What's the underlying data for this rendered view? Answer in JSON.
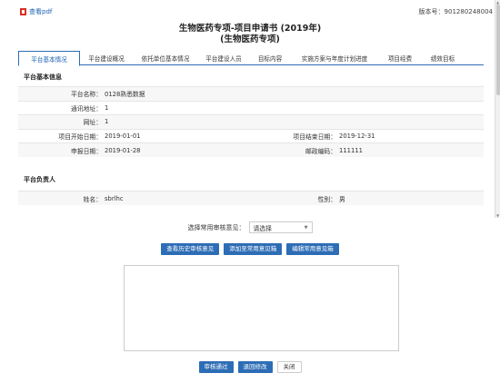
{
  "header": {
    "pdf_link": "查看pdf",
    "version": "版本号：901280248004",
    "title": "生物医药专项-项目申请书 (2019年)",
    "subtitle": "(生物医药专项)"
  },
  "tabs": [
    {
      "label": "平台基本情况",
      "active": true
    },
    {
      "label": "平台建设概况",
      "active": false
    },
    {
      "label": "依托单位基本情况",
      "active": false
    },
    {
      "label": "平台建设人员",
      "active": false
    },
    {
      "label": "目标内容",
      "active": false
    },
    {
      "label": "实施方案与年度计划进度",
      "active": false
    },
    {
      "label": "项目经费",
      "active": false
    },
    {
      "label": "绩效目标",
      "active": false
    }
  ],
  "basic_info": {
    "section_title": "平台基本信息",
    "name_label": "平台名称：",
    "name_value": "0128熟悉数据",
    "address_label": "通讯地址：",
    "address_value": "1",
    "website_label": "网址：",
    "website_value": "1",
    "start_label": "项目开始日期：",
    "start_value": "2019-01-01",
    "end_label": "项目结束日期：",
    "end_value": "2019-12-31",
    "report_label": "申报日期：",
    "report_value": "2019-01-28",
    "postcode_label": "邮政编码：",
    "postcode_value": "111111"
  },
  "leader": {
    "section_title": "平台负责人",
    "name_label": "姓名：",
    "name_value": "sbrlhc",
    "gender_label": "性别：",
    "gender_value": "男"
  },
  "review": {
    "select_label": "选择常用审核意见：",
    "select_value": "请选择",
    "history_btn": "查看历史审核意见",
    "add_btn": "添加至常用意见箱",
    "edit_btn": "编辑常用意见箱",
    "approve_btn": "审核通过",
    "return_btn": "退回修改",
    "close_btn": "关闭"
  },
  "colors": {
    "accent": "#2d6db5",
    "link": "#1a5fb4",
    "pdf_icon": "#d93025"
  }
}
